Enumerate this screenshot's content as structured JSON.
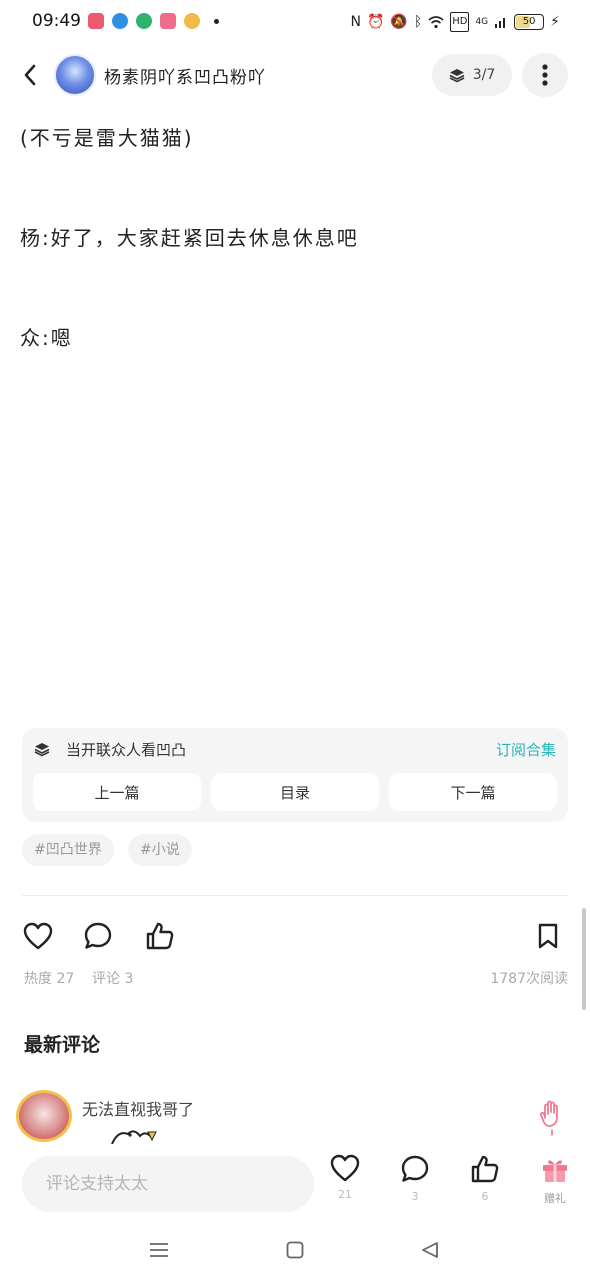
{
  "status_bar": {
    "time": "09:49",
    "battery": "50",
    "network": "4G",
    "icons": [
      "nfc-icon",
      "alarm-icon",
      "mute-icon",
      "bluetooth-icon",
      "wifi-icon",
      "hd-icon",
      "signal-icon",
      "charging-icon"
    ]
  },
  "header": {
    "author_name": "杨素阴吖系凹凸粉吖",
    "pager": "3/7"
  },
  "content": {
    "lines": [
      "(不亏是雷大猫猫)",
      "杨:好了，大家赶紧回去休息休息吧",
      "众:嗯"
    ]
  },
  "collection": {
    "title": "当开联众人看凹凸",
    "subscribe_label": "订阅合集",
    "prev_label": "上一篇",
    "toc_label": "目录",
    "next_label": "下一篇"
  },
  "tags": [
    "#凹凸世界",
    "#小说"
  ],
  "stats": {
    "heat": "热度 27",
    "comments": "评论 3",
    "reads": "1787次阅读"
  },
  "comments_section": {
    "title": "最新评论",
    "first_comment": "无法直视我哥了"
  },
  "bottom_bar": {
    "input_placeholder": "评论支持太太",
    "like_count": "21",
    "comment_count": "3",
    "thumb_count": "6",
    "gift_label": "赠礼"
  },
  "colors": {
    "accent": "#2bb5b8",
    "gift": "#f07a8f"
  }
}
